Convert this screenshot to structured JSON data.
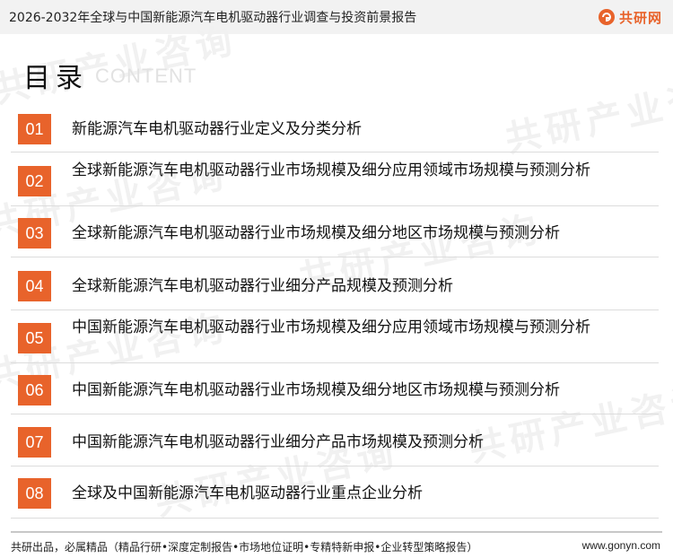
{
  "header": {
    "title": "2026-2032年全球与中国新能源汽车电机驱动器行业调查与投资前景报告",
    "logo_text": "共研网"
  },
  "toc": {
    "title": "目录",
    "subtitle": "CONTENT",
    "items": [
      {
        "num": "01",
        "text": "新能源汽车电机驱动器行业定义及分类分析"
      },
      {
        "num": "02",
        "text": "全球新能源汽车电机驱动器行业市场规模及细分应用领域市场规模与预测分析"
      },
      {
        "num": "03",
        "text": "全球新能源汽车电机驱动器行业市场规模及细分地区市场规模与预测分析"
      },
      {
        "num": "04",
        "text": "全球新能源汽车电机驱动器行业细分产品规模及预测分析"
      },
      {
        "num": "05",
        "text": "中国新能源汽车电机驱动器行业市场规模及细分应用领域市场规模与预测分析"
      },
      {
        "num": "06",
        "text": "中国新能源汽车电机驱动器行业市场规模及细分地区市场规模与预测分析"
      },
      {
        "num": "07",
        "text": "中国新能源汽车电机驱动器行业细分产品市场规模及预测分析"
      },
      {
        "num": "08",
        "text": "全球及中国新能源汽车电机驱动器行业重点企业分析"
      }
    ]
  },
  "watermark": {
    "text": "共研产业咨询"
  },
  "footer": {
    "left": "共研出品，必属精品（精品行研•深度定制报告•市场地位证明•专精特新申报•企业转型策略报告）",
    "right": "www.gonyn.com"
  },
  "colors": {
    "accent": "#e8632b",
    "header_bg": "#f2f2f2"
  }
}
